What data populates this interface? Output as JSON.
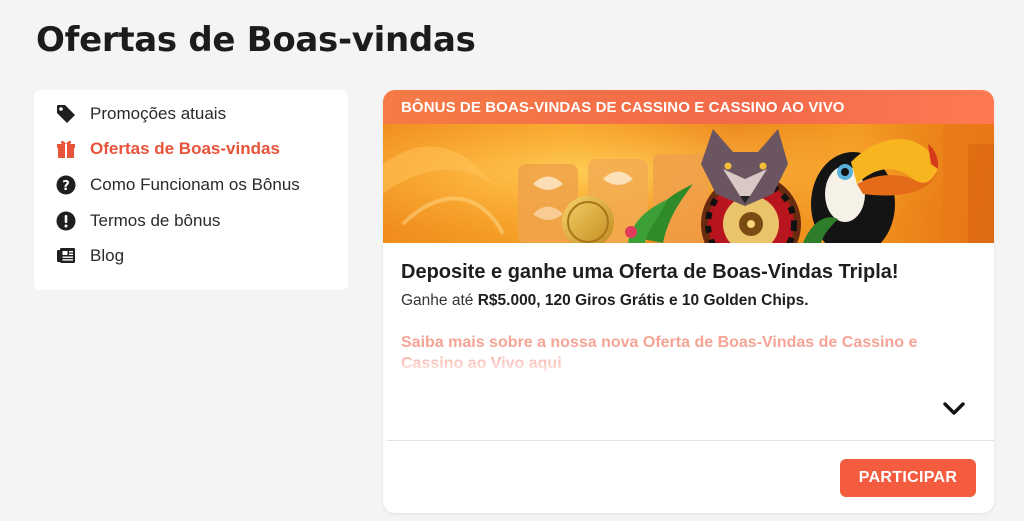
{
  "page": {
    "title": "Ofertas de Boas-vindas"
  },
  "sidebar": {
    "items": [
      {
        "label": "Promoções atuais",
        "icon": "tag-icon",
        "active": false
      },
      {
        "label": "Ofertas de Boas-vindas",
        "icon": "gift-icon",
        "active": true
      },
      {
        "label": "Como Funcionam os Bônus",
        "icon": "question-circle-icon",
        "active": false
      },
      {
        "label": "Termos de bônus",
        "icon": "exclamation-circle-icon",
        "active": false
      },
      {
        "label": "Blog",
        "icon": "newspaper-icon",
        "active": false
      }
    ]
  },
  "card": {
    "header": "BÔNUS DE BOAS-VINDAS DE CASSINO E CASSINO AO VIVO",
    "banner_image": "casino-banner-image",
    "title": "Deposite e ganhe uma Oferta de Boas-Vindas Tripla!",
    "subtitle_prefix": "Ganhe até ",
    "subtitle_bold": "R$5.000, 120 Giros Grátis e 10 Golden Chips.",
    "more_link": "Saiba mais sobre a nossa nova Oferta de Boas-Vindas de Cassino e Cassino ao Vivo aqui",
    "expand_icon": "chevron-down-icon",
    "cta_label": "PARTICIPAR"
  },
  "colors": {
    "accent": "#f35c3f",
    "header_gradient_start": "#f57a45",
    "active_text": "#e8533a",
    "background": "#f4f4f4"
  }
}
